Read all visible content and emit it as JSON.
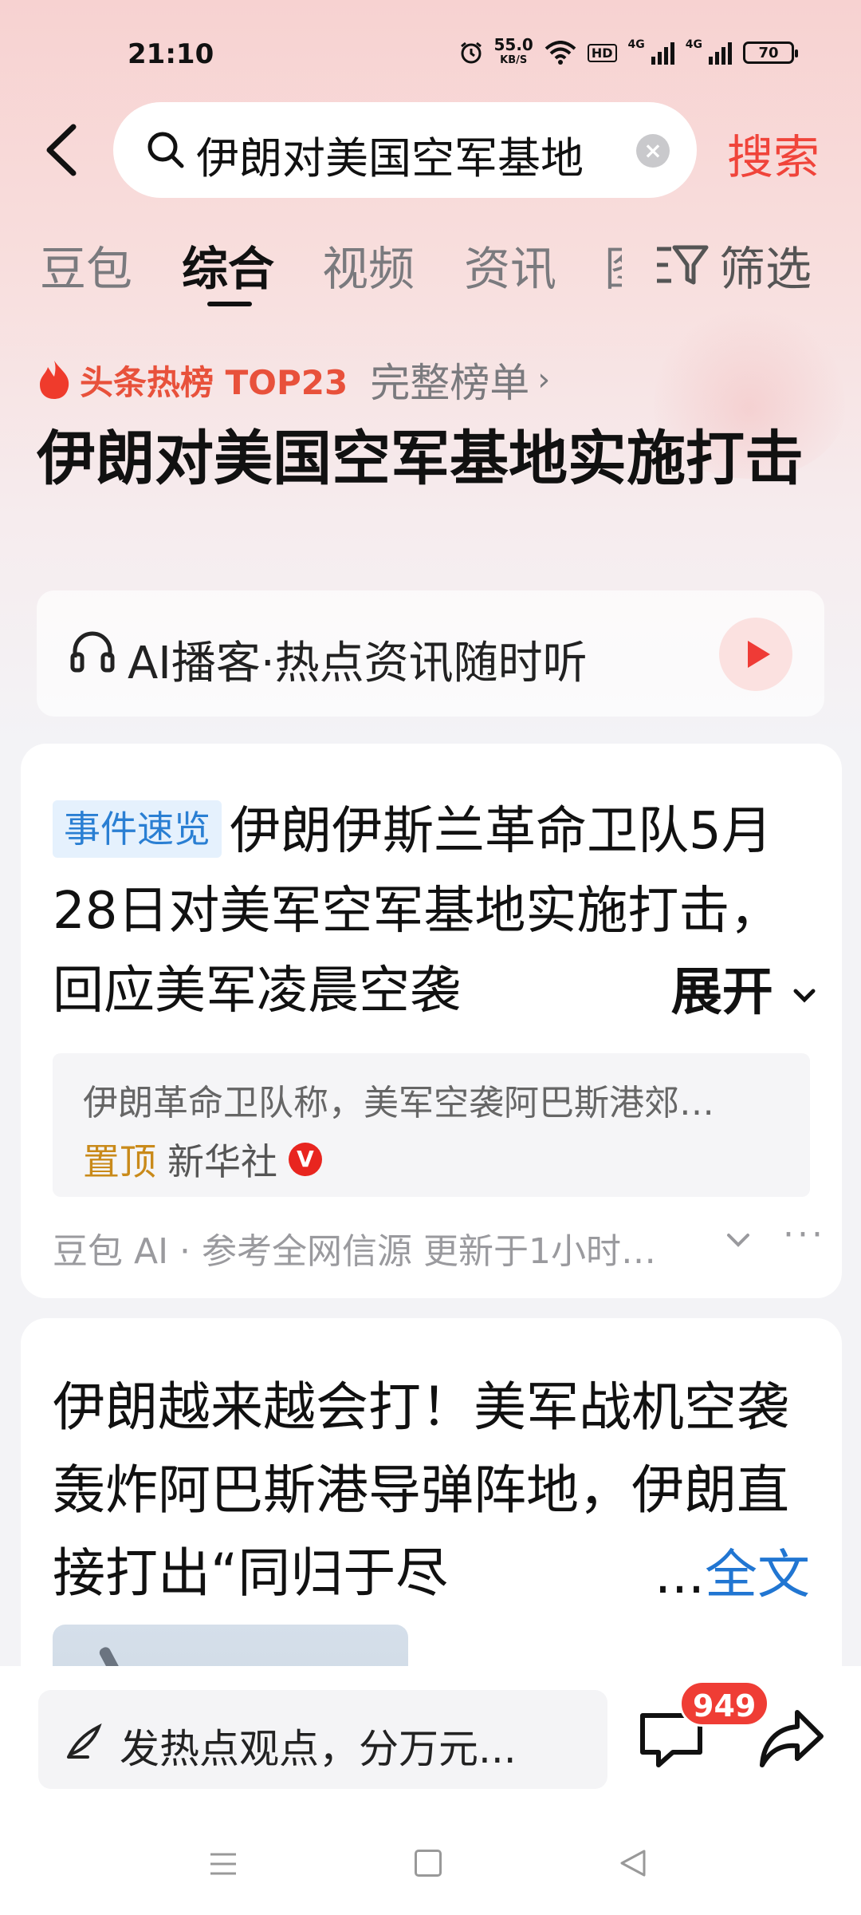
{
  "status_bar": {
    "time": "21:10",
    "net_speed": "55.0",
    "net_speed_unit": "KB/S",
    "hd_label": "HD",
    "network_1": "4G",
    "network_2": "4G",
    "battery": "70"
  },
  "search": {
    "query": "伊朗对美国空军基地",
    "clear_label": "×",
    "button_label": "搜索"
  },
  "tabs": [
    {
      "label": "豆包",
      "active": false
    },
    {
      "label": "综合",
      "active": true
    },
    {
      "label": "视频",
      "active": false
    },
    {
      "label": "资讯",
      "active": false
    },
    {
      "label": "图",
      "active": false
    }
  ],
  "filter_label": "筛选",
  "hot_topic": {
    "label": "头条热榜 TOP23",
    "full_list_label": "完整榜单",
    "title": "伊朗对美国空军基地实施打击"
  },
  "podcast": {
    "label": "AI播客·热点资讯随时听"
  },
  "event_card": {
    "badge": "事件速览",
    "text": "伊朗伊斯兰革命卫队5月28日对美军空军基地实施打击，回应美军凌晨空袭",
    "expand_label": "展开",
    "source_snippet": "伊朗革命卫队称，美军空袭阿巴斯港郊…",
    "pinned_label": "置顶",
    "source_name": "新华社",
    "verified_mark": "V",
    "footer": "豆包 AI · 参考全网信源 更新于1小时…",
    "more_label": "···"
  },
  "article_card": {
    "title": "伊朗越来越会打！美军战机空袭轰炸阿巴斯港导弹阵地，伊朗直接打出“同归于尽",
    "ellipsis": "...",
    "full_text_label": "全文"
  },
  "bottom_bar": {
    "comment_placeholder": "发热点观点，分万元...",
    "comment_count": "949"
  },
  "colors": {
    "accent_red": "#f0443a",
    "link_blue": "#2176d2",
    "badge_blue_bg": "#e5f1fd"
  }
}
